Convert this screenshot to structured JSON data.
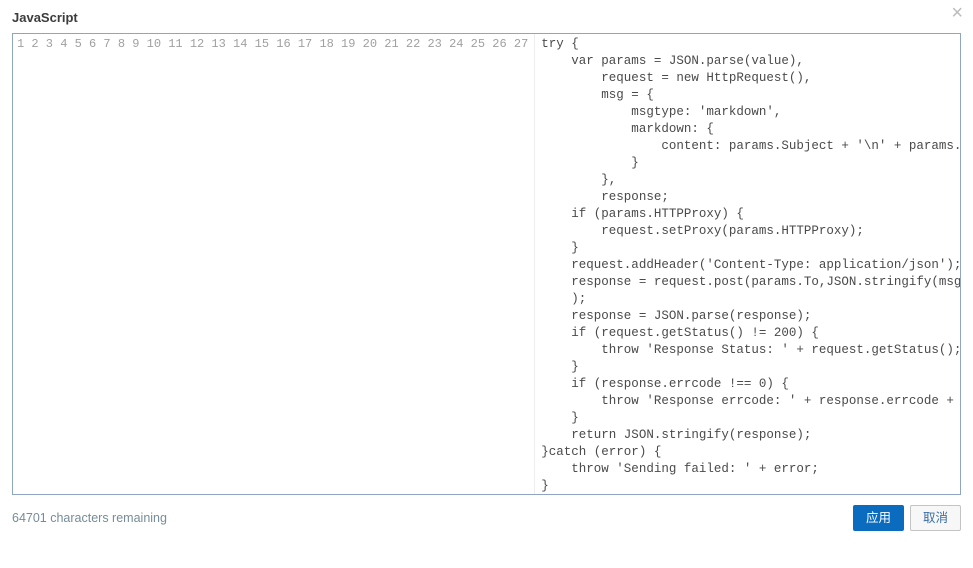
{
  "header": {
    "title": "JavaScript",
    "close_icon": "×"
  },
  "editor": {
    "line_count": 27,
    "lines": [
      "try {",
      "    var params = JSON.parse(value),",
      "        request = new HttpRequest(),",
      "        msg = {",
      "            msgtype: 'markdown',",
      "            markdown: {",
      "                content: params.Subject + '\\n' + params.Message",
      "            }",
      "        },",
      "        response;",
      "    if (params.HTTPProxy) {",
      "        request.setProxy(params.HTTPProxy);",
      "    }",
      "    request.addHeader('Content-Type: application/json');",
      "    response = request.post(params.To,JSON.stringify(msg)",
      "    );",
      "    response = JSON.parse(response);",
      "    if (request.getStatus() != 200) {",
      "        throw 'Response Status: ' + request.getStatus();",
      "    }",
      "    if (response.errcode !== 0) {",
      "        throw 'Response errcode: ' + response.errcode + '\\n' + 'Response errmsg: ' + response.errmsg;",
      "    }",
      "    return JSON.stringify(response);",
      "}catch (error) {",
      "    throw 'Sending failed: ' + error;",
      "}"
    ]
  },
  "footer": {
    "status_text": "64701 characters remaining",
    "apply_label": "应用",
    "cancel_label": "取消"
  },
  "watermark": ""
}
